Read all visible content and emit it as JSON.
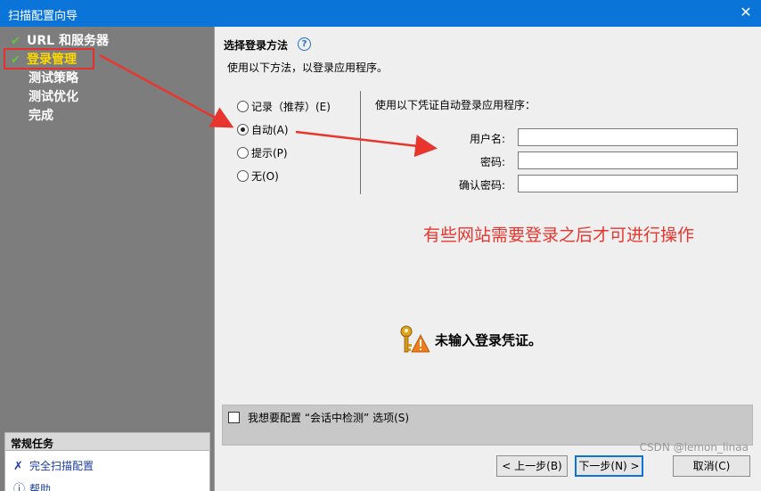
{
  "window": {
    "title": "扫描配置向导",
    "close_glyph": "✕"
  },
  "steps": [
    {
      "label": "URL 和服务器",
      "done": true
    },
    {
      "label": "登录管理",
      "done": true,
      "active": true
    },
    {
      "label": "测试策略",
      "done": false
    },
    {
      "label": "测试优化",
      "done": false
    },
    {
      "label": "完成",
      "done": false
    }
  ],
  "tasks": {
    "header": "常规任务",
    "items": [
      {
        "label": "完全扫描配置",
        "icon": "tools-icon"
      },
      {
        "label": "帮助",
        "icon": "help-icon"
      }
    ]
  },
  "section": {
    "title": "选择登录方法",
    "help_glyph": "?",
    "description": "使用以下方法，以登录应用程序。"
  },
  "login_methods": [
    {
      "label": "记录（推荐）(E)",
      "selected": false
    },
    {
      "label": "自动(A)",
      "selected": true
    },
    {
      "label": "提示(P)",
      "selected": false
    },
    {
      "label": "无(O)",
      "selected": false
    }
  ],
  "credentials": {
    "description": "使用以下凭证自动登录应用程序：",
    "username_label": "用户名:",
    "password_label": "密码:",
    "confirm_label": "确认密码:",
    "username_value": "",
    "password_value": "",
    "confirm_value": ""
  },
  "annotation": "有些网站需要登录之后才可进行操作",
  "warning": {
    "text": "未输入登录凭证。"
  },
  "session_option": {
    "label": "我想要配置 “会话中检测” 选项(S)",
    "checked": false
  },
  "buttons": {
    "back": "< 上一步(B)",
    "next": "下一步(N) >",
    "cancel": "取消(C)"
  },
  "watermark": "CSDN @lemon_linaa",
  "colors": {
    "titlebar": "#0a74d8",
    "sidebar": "#7d7d7d",
    "active_step": "#ffd800",
    "check": "#63c43a",
    "annotation": "#e8362e"
  }
}
